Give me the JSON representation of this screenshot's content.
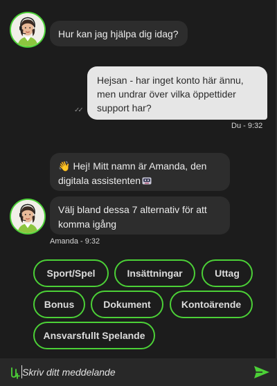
{
  "messages": {
    "bot_greeting": "Hur kan jag hjälpa dig idag?",
    "user_question": "Hejsan - har inget konto här ännu, men undrar över vilka öppettider support har?",
    "user_meta": "Du - 9:32",
    "bot_intro": "Hej! Mitt namn är Amanda, den digitala assistenten",
    "bot_options": "Välj bland dessa 7 alternativ för att komma igång",
    "bot_meta": "Amanda - 9:32"
  },
  "options": [
    "Sport/Spel",
    "Insättningar",
    "Uttag",
    "Bonus",
    "Dokument",
    "Kontoärende",
    "Ansvarsfullt Spelande"
  ],
  "composer": {
    "placeholder": "Skriv ditt meddelande"
  },
  "icons": {
    "avatar": "assistant-avatar",
    "wave": "waving-hand-icon",
    "robot": "robot-face-icon",
    "ticks": "read-receipt-icon",
    "attach": "attach-icon",
    "send": "send-icon"
  },
  "colors": {
    "background": "#1c1c1c",
    "bot_bubble": "#2d2d2d",
    "user_bubble": "#e6e6e6",
    "accent": "#4cd137",
    "composer": "#282828"
  }
}
